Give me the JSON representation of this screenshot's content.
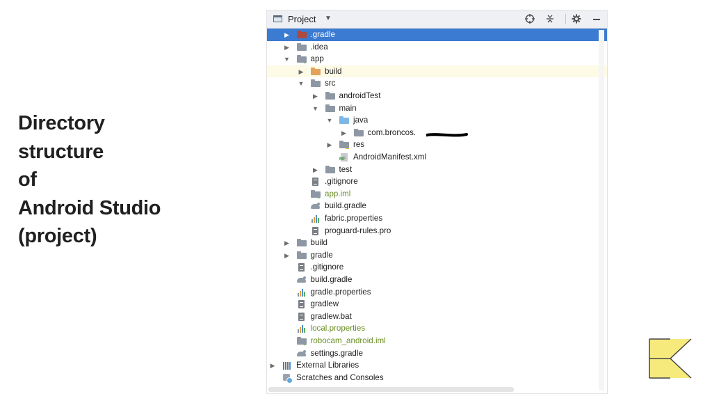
{
  "slide": {
    "title_lines": [
      "Directory",
      "structure",
      "of",
      "Android Studio",
      "(project)"
    ]
  },
  "panel": {
    "title": "Project",
    "header_icons": [
      "window-icon",
      "dropdown-caret-icon",
      "locate-icon",
      "collapse-all-icon",
      "gear-icon",
      "minimize-icon"
    ]
  },
  "tree": [
    {
      "label": ".gradle",
      "arrow": "collapsed",
      "icon": "folder-red-icon",
      "selected": true
    },
    {
      "label": ".idea",
      "arrow": "collapsed",
      "icon": "folder-icon"
    },
    {
      "label": "app",
      "arrow": "expanded",
      "icon": "module-folder-icon"
    },
    {
      "label": "build",
      "arrow": "collapsed",
      "icon": "folder-orange-icon",
      "highlight": true
    },
    {
      "label": "src",
      "arrow": "expanded",
      "icon": "folder-icon"
    },
    {
      "label": "androidTest",
      "arrow": "collapsed",
      "icon": "folder-icon"
    },
    {
      "label": "main",
      "arrow": "expanded",
      "icon": "folder-icon"
    },
    {
      "label": "java",
      "arrow": "expanded",
      "icon": "folder-blue-icon"
    },
    {
      "label": "com.broncos.",
      "arrow": "collapsed",
      "icon": "package-icon"
    },
    {
      "label": "res",
      "arrow": "collapsed",
      "icon": "resource-folder-icon"
    },
    {
      "label": "AndroidManifest.xml",
      "arrow": "",
      "icon": "manifest-icon"
    },
    {
      "label": "test",
      "arrow": "collapsed",
      "icon": "folder-icon"
    },
    {
      "label": ".gitignore",
      "arrow": "",
      "icon": "text-file-icon"
    },
    {
      "label": "app.iml",
      "arrow": "",
      "icon": "module-file-icon"
    },
    {
      "label": "build.gradle",
      "arrow": "",
      "icon": "gradle-icon"
    },
    {
      "label": "fabric.properties",
      "arrow": "",
      "icon": "properties-icon"
    },
    {
      "label": "proguard-rules.pro",
      "arrow": "",
      "icon": "text-file-icon"
    },
    {
      "label": "build",
      "arrow": "collapsed",
      "icon": "folder-icon"
    },
    {
      "label": "gradle",
      "arrow": "collapsed",
      "icon": "folder-icon"
    },
    {
      "label": ".gitignore",
      "arrow": "",
      "icon": "text-file-icon"
    },
    {
      "label": "build.gradle",
      "arrow": "",
      "icon": "gradle-icon"
    },
    {
      "label": "gradle.properties",
      "arrow": "",
      "icon": "properties-icon"
    },
    {
      "label": "gradlew",
      "arrow": "",
      "icon": "text-file-icon"
    },
    {
      "label": "gradlew.bat",
      "arrow": "",
      "icon": "text-file-icon"
    },
    {
      "label": "local.properties",
      "arrow": "",
      "icon": "properties-icon"
    },
    {
      "label": "robocam_android.iml",
      "arrow": "",
      "icon": "module-file-icon"
    },
    {
      "label": "settings.gradle",
      "arrow": "",
      "icon": "gradle-icon"
    },
    {
      "label": "External Libraries",
      "arrow": "collapsed",
      "icon": "libraries-icon"
    },
    {
      "label": "Scratches and Consoles",
      "arrow": "",
      "icon": "scratches-icon"
    }
  ],
  "colors": {
    "selection": "#3b7bd1",
    "highlight_row": "#fdfae5",
    "logo_yellow": "#f7ea7c"
  },
  "logo": {
    "icon": "k-logo-icon"
  }
}
